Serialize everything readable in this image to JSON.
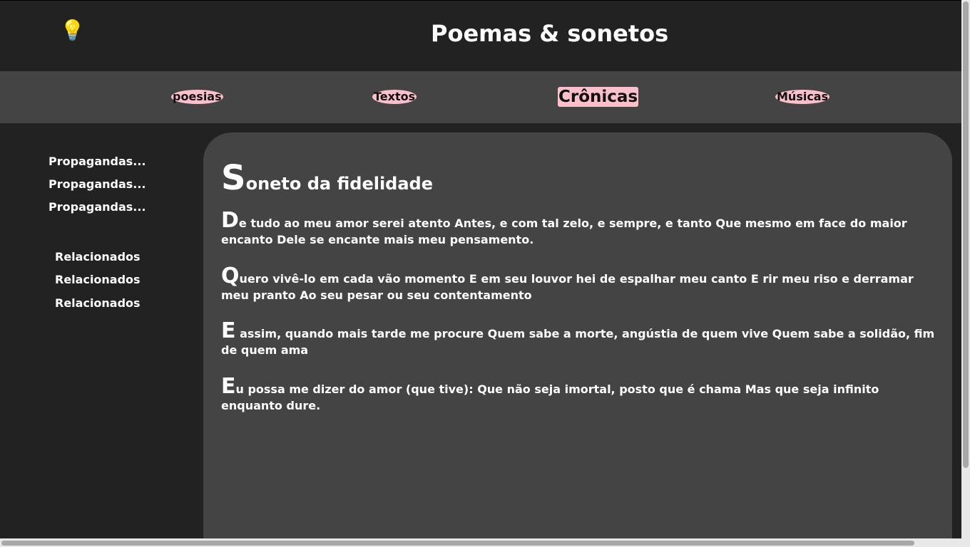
{
  "header": {
    "logo_icon": "lightbulb-icon",
    "logo_glyph": "💡",
    "title": "Poemas & sonetos"
  },
  "nav": {
    "items": [
      {
        "label": "poesias"
      },
      {
        "label": "Textos"
      },
      {
        "label": "Crônicas"
      },
      {
        "label": "Músicas"
      }
    ],
    "active": "Crônicas",
    "accent_color": "#ffc0cb"
  },
  "sidebar": {
    "ads": [
      "Propagandas...",
      "Propagandas...",
      "Propagandas..."
    ],
    "related": [
      "Relacionados",
      "Relacionados",
      "Relacionados"
    ]
  },
  "poem": {
    "title_initial": "S",
    "title_rest": "oneto da fidelidade",
    "stanzas": [
      {
        "initial": "D",
        "text": "e tudo ao meu amor serei atento Antes, e com tal zelo, e sempre, e tanto Que mesmo em face do maior encanto Dele se encante mais meu pensamento."
      },
      {
        "initial": "Q",
        "text": "uero vivê-lo em cada vão momento E em seu louvor hei de espalhar meu canto E rir meu riso e derramar meu pranto Ao seu pesar ou seu contentamento"
      },
      {
        "initial": "E",
        "text": " assim, quando mais tarde me procure Quem sabe a morte, angústia de quem vive Quem sabe a solidão, fim de quem ama"
      },
      {
        "initial": "E",
        "text": "u possa me dizer do amor (que tive): Que não seja imortal, posto que é chama Mas que seja infinito enquanto dure."
      }
    ]
  },
  "colors": {
    "background": "#222222",
    "panel": "#444444",
    "text": "#ffffff"
  }
}
